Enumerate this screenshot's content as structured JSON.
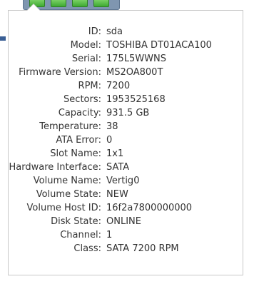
{
  "disk_details": {
    "rows": [
      {
        "label": "ID:",
        "value": "sda"
      },
      {
        "label": "Model:",
        "value": "TOSHIBA DT01ACA100"
      },
      {
        "label": "Serial:",
        "value": "175L5WWNS"
      },
      {
        "label": "Firmware Version:",
        "value": "MS2OA800T"
      },
      {
        "label": "RPM:",
        "value": "7200"
      },
      {
        "label": "Sectors:",
        "value": "1953525168"
      },
      {
        "label": "Capacity:",
        "value": "931.5 GB"
      },
      {
        "label": "Temperature:",
        "value": "38"
      },
      {
        "label": "ATA Error:",
        "value": "0"
      },
      {
        "label": "Slot Name:",
        "value": "1x1"
      },
      {
        "label": "Hardware Interface:",
        "value": "SATA"
      },
      {
        "label": "Volume Name:",
        "value": "Vertig0"
      },
      {
        "label": "Volume State:",
        "value": "NEW"
      },
      {
        "label": "Volume Host ID:",
        "value": "16f2a7800000000"
      },
      {
        "label": "Disk State:",
        "value": "ONLINE"
      },
      {
        "label": "Channel:",
        "value": "1"
      },
      {
        "label": "Class:",
        "value": "SATA 7200 RPM"
      }
    ]
  },
  "colors": {
    "text": "#333333",
    "border": "#c8c8c8",
    "drive_led": "#3eaa32",
    "bay": "#7f96b0"
  }
}
